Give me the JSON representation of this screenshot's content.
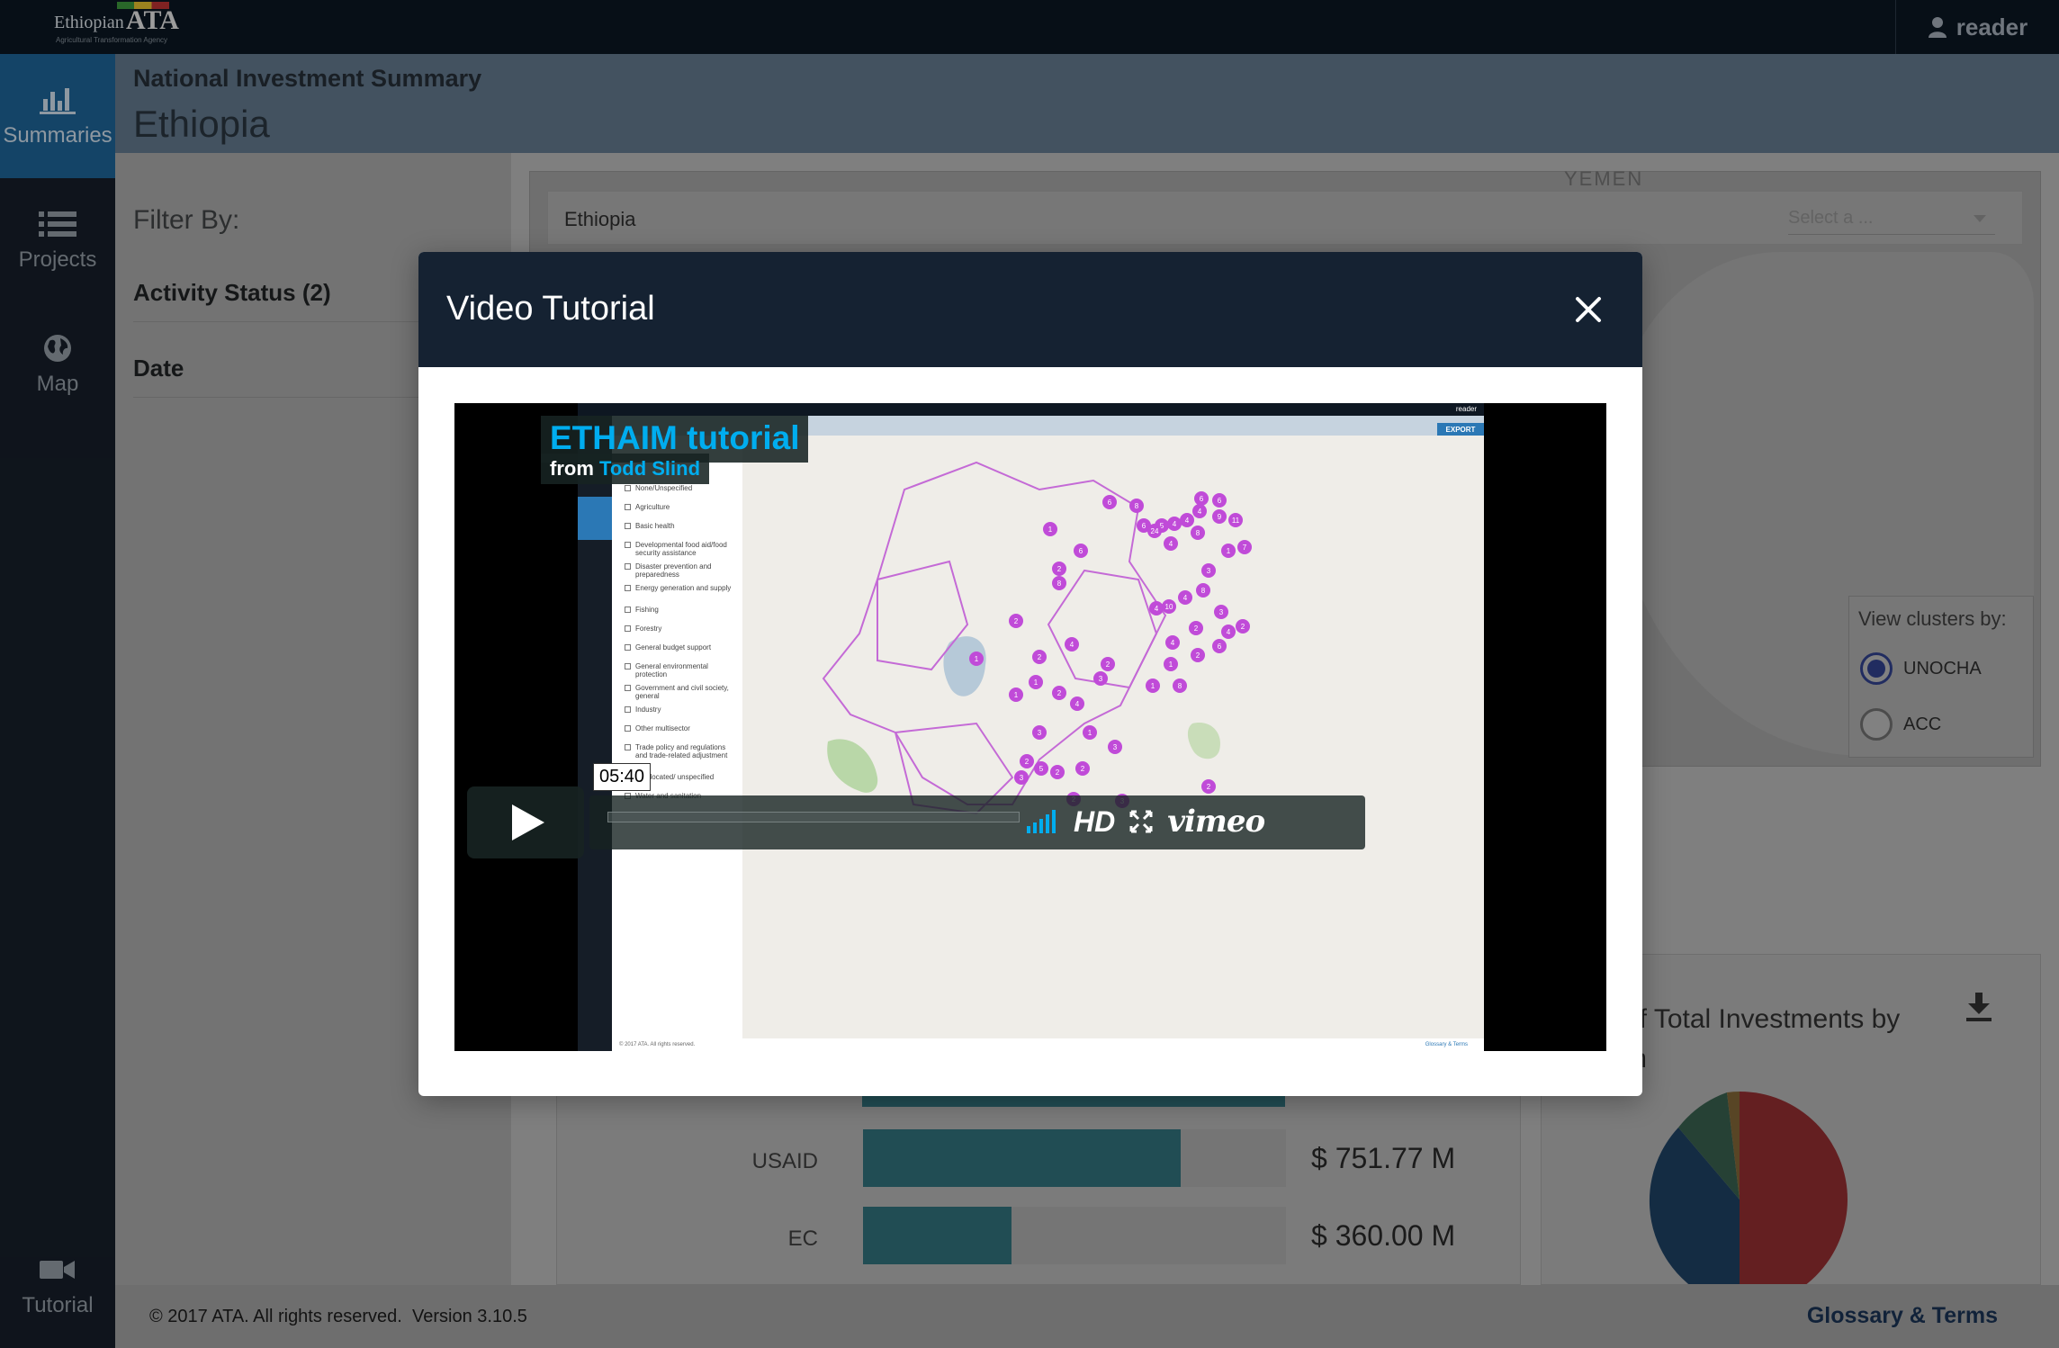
{
  "app": {
    "logo_text": "Ethiopian",
    "logo_ata": "ATA",
    "logo_sub": "Agricultural Transformation Agency",
    "user": "reader"
  },
  "sidebar": {
    "items": [
      {
        "label": "Summaries",
        "icon": "bar-chart-icon",
        "active": true
      },
      {
        "label": "Projects",
        "icon": "list-icon",
        "active": false
      },
      {
        "label": "Map",
        "icon": "globe-icon",
        "active": false
      },
      {
        "label": "Tutorial",
        "icon": "video-camera-icon",
        "active": false
      }
    ]
  },
  "header": {
    "pretitle": "National Investment Summary",
    "title": "Ethiopia"
  },
  "filters": {
    "label": "Filter By:",
    "rows": [
      "Activity Status (2)",
      "Date"
    ]
  },
  "map": {
    "search_value": "Ethiopia",
    "select_placeholder": "Select a ...",
    "country_label": "YEMEN",
    "clusters_title": "View clusters by:",
    "cluster_options": [
      {
        "label": "UNOCHA",
        "selected": true
      },
      {
        "label": "ACC",
        "selected": false
      }
    ]
  },
  "bars": {
    "rows": [
      {
        "label": "USAID",
        "value": "$ 751.77 M",
        "fraction": 0.75
      },
      {
        "label": "EC",
        "value": "$ 360.00 M",
        "fraction": 0.35
      }
    ]
  },
  "pie": {
    "title": "of Total Investments by",
    "title_line2": "m",
    "colors": [
      "#8b2c2f",
      "#1d3e5e",
      "#355a4a",
      "#7a6034"
    ]
  },
  "footer": {
    "copyright": "© 2017 ATA. All rights reserved.",
    "version": "Version 3.10.5",
    "glossary": "Glossary & Terms"
  },
  "modal": {
    "title": "Video Tutorial",
    "video": {
      "title": "ETHAIM tutorial",
      "from": "from",
      "author": "Todd Slind",
      "time": "05:40",
      "hd": "HD",
      "brand": "vimeo",
      "inner_user": "reader",
      "inner_export": "EXPORT",
      "inner_footer": "© 2017 ATA. All rights reserved.",
      "inner_glossary": "Glossary & Terms",
      "sectors": [
        "None/Unspecified",
        "Agriculture",
        "Basic health",
        "Developmental food aid/food security assistance",
        "Disaster prevention and preparedness",
        "Energy generation and supply",
        "Fishing",
        "Forestry",
        "General budget support",
        "General environmental protection",
        "Government and civil society, general",
        "Industry",
        "Other multisector",
        "Trade policy and regulations and trade-related adjustment",
        "Unallocated/ unspecified",
        "Water and sanitation"
      ],
      "clusters": [
        {
          "n": "6"
        },
        {
          "n": "8"
        },
        {
          "n": "6"
        },
        {
          "n": "5"
        },
        {
          "n": "4"
        },
        {
          "n": "24"
        },
        {
          "n": "4"
        },
        {
          "n": "4"
        },
        {
          "n": "6"
        },
        {
          "n": "6"
        },
        {
          "n": "9"
        },
        {
          "n": "11"
        },
        {
          "n": "1"
        },
        {
          "n": "7"
        },
        {
          "n": "4"
        },
        {
          "n": "8"
        },
        {
          "n": "3"
        },
        {
          "n": "1"
        },
        {
          "n": "6"
        },
        {
          "n": "2"
        },
        {
          "n": "8"
        },
        {
          "n": "2"
        },
        {
          "n": "4"
        },
        {
          "n": "4"
        },
        {
          "n": "10"
        },
        {
          "n": "8"
        },
        {
          "n": "3"
        },
        {
          "n": "2"
        },
        {
          "n": "4"
        },
        {
          "n": "6"
        },
        {
          "n": "4"
        },
        {
          "n": "2"
        },
        {
          "n": "2"
        },
        {
          "n": "1"
        },
        {
          "n": "1"
        },
        {
          "n": "8"
        },
        {
          "n": "4"
        },
        {
          "n": "2"
        },
        {
          "n": "1"
        },
        {
          "n": "2"
        },
        {
          "n": "2"
        },
        {
          "n": "4"
        },
        {
          "n": "3"
        },
        {
          "n": "1"
        },
        {
          "n": "1"
        },
        {
          "n": "3"
        },
        {
          "n": "2"
        },
        {
          "n": "3"
        },
        {
          "n": "5"
        },
        {
          "n": "2"
        },
        {
          "n": "2"
        },
        {
          "n": "1"
        },
        {
          "n": "3"
        },
        {
          "n": "2"
        },
        {
          "n": "3"
        },
        {
          "n": "2"
        }
      ]
    }
  }
}
